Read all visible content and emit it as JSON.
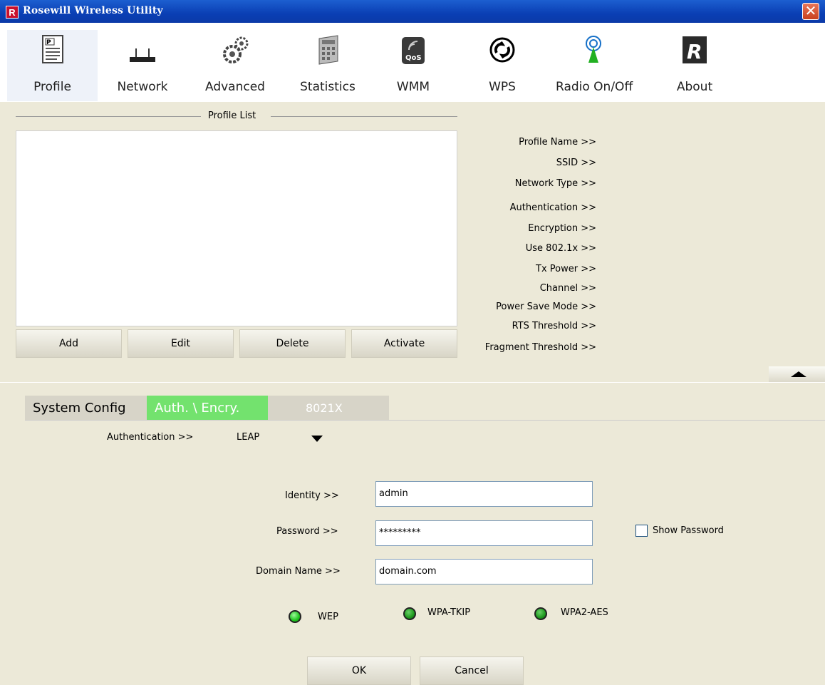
{
  "window": {
    "title": "Rosewill Wireless Utility",
    "logo_letter": "R",
    "close_glyph": "✕"
  },
  "toolbar": [
    {
      "label": "Profile",
      "icon": "profile-icon"
    },
    {
      "label": "Network",
      "icon": "router-icon"
    },
    {
      "label": "Advanced",
      "icon": "gears-icon"
    },
    {
      "label": "Statistics",
      "icon": "calculator-icon"
    },
    {
      "label": "WMM",
      "icon": "qos-icon"
    },
    {
      "label": "WPS",
      "icon": "wps-icon"
    },
    {
      "label": "Radio On/Off",
      "icon": "antenna-icon"
    },
    {
      "label": "About",
      "icon": "rosewill-logo-icon"
    }
  ],
  "profile_list": {
    "title": "Profile List",
    "buttons": {
      "add": "Add",
      "edit": "Edit",
      "delete": "Delete",
      "activate": "Activate"
    }
  },
  "profile_info": {
    "profile_name": "Profile Name >>",
    "ssid": "SSID >>",
    "network_type": "Network Type >>",
    "authentication": "Authentication >>",
    "encryption": "Encryption >>",
    "use_8021x": "Use 802.1x >>",
    "tx_power": "Tx Power >>",
    "channel": "Channel >>",
    "power_save_mode": "Power Save Mode >>",
    "rts_threshold": "RTS Threshold >>",
    "fragment_threshold": "Fragment Threshold >>"
  },
  "tabs": {
    "system_config": "System Config",
    "auth_encry": "Auth. \\ Encry.",
    "8021x": "8021X"
  },
  "auth": {
    "label": "Authentication >>",
    "value": "LEAP",
    "identity_label": "Identity >>",
    "identity_value": "admin",
    "password_label": "Password >>",
    "password_value": "*********",
    "show_password": "Show Password",
    "domain_label": "Domain Name >>",
    "domain_value": "domain.com"
  },
  "indicators": {
    "wep": "WEP",
    "wpa_tkip": "WPA-TKIP",
    "wpa2_aes": "WPA2-AES"
  },
  "actions": {
    "ok": "OK",
    "cancel": "Cancel"
  },
  "colors": {
    "title_bar": "#0a3fb4",
    "active_tab": "#73e26e",
    "window_bg": "#ece9d8"
  }
}
